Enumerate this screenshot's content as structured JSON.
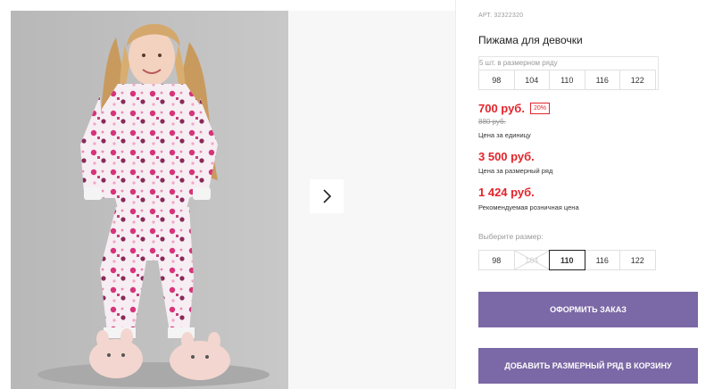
{
  "product": {
    "article": "АРТ. 32322320",
    "title": "Пижама для девочки"
  },
  "size_range": {
    "label": "5 шт. в размерном ряду",
    "sizes": [
      "98",
      "104",
      "110",
      "116",
      "122"
    ]
  },
  "pricing": {
    "unit_price": "700 руб.",
    "discount": "20%",
    "old_price": "880 руб.",
    "unit_caption": "Цена за единицу",
    "range_price": "3 500 руб.",
    "range_caption": "Цена за размерный ряд",
    "retail_price": "1 424 руб.",
    "retail_caption": "Рекомендуемая розничная цена"
  },
  "size_selector": {
    "label": "Выберите размер:",
    "sizes": [
      "98",
      "104",
      "110",
      "116",
      "122"
    ],
    "selected": "110",
    "disabled": "104"
  },
  "actions": {
    "order": "ОФОРМИТЬ ЗАКАЗ",
    "add_to_cart": "ДОБАВИТЬ РАЗМЕРНЫЙ РЯД В КОРЗИНУ"
  },
  "colors": {
    "price": "#e3242b",
    "button": "#7b68a6",
    "pajama_print": "#d6337a"
  }
}
